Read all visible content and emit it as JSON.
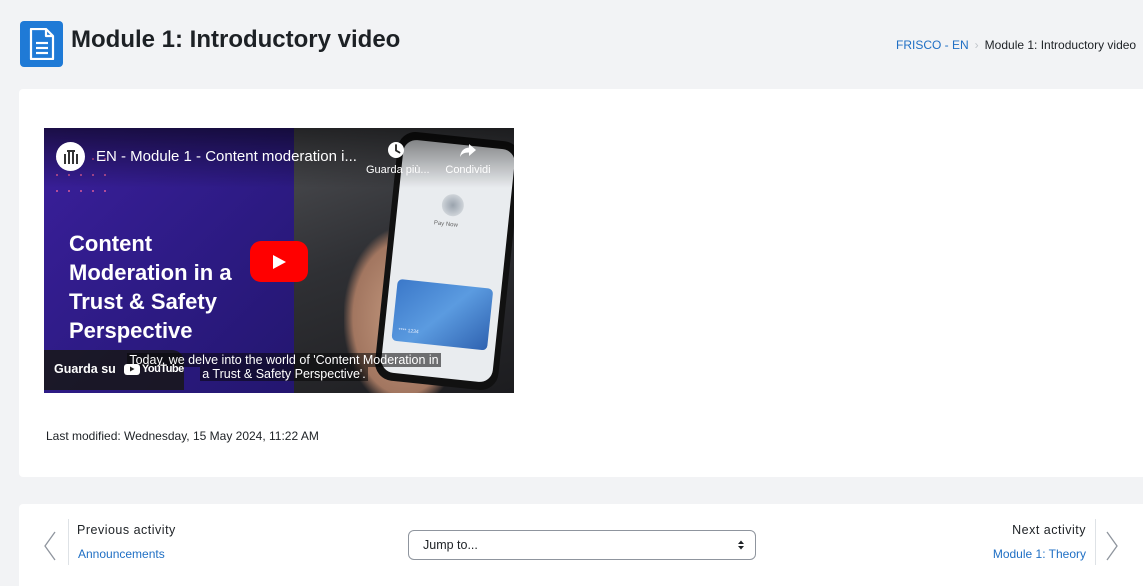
{
  "header": {
    "title": "Module 1: Introductory video",
    "icon": "page-icon",
    "accent_color": "#1f7ad6"
  },
  "breadcrumb": {
    "items": [
      "FRISCO - EN",
      "Module 1: Introductory video"
    ]
  },
  "video": {
    "title": "EN - Module 1 - Content moderation i...",
    "watch_later_label": "Guarda più...",
    "share_label": "Condividi",
    "headline_lines": [
      "Content",
      "Moderation in a",
      "Trust & Safety",
      "Perspective"
    ],
    "caption_lines": [
      "Today, we delve into the world of 'Content Moderation in",
      "a Trust & Safety Perspective'."
    ],
    "watch_on_label": "Guarda su",
    "youtube_label": "YouTube",
    "phone_pay_label": "Pay Now",
    "phone_card_number": "**** 1234",
    "play_color": "#ff0000"
  },
  "last_modified": "Last modified: Wednesday, 15 May 2024, 11:22 AM",
  "navigation": {
    "previous_title": "Previous activity",
    "previous_link": "Announcements",
    "jump_placeholder": "Jump to...",
    "next_title": "Next activity",
    "next_link": "Module 1: Theory",
    "link_color": "#1f6fc4"
  }
}
